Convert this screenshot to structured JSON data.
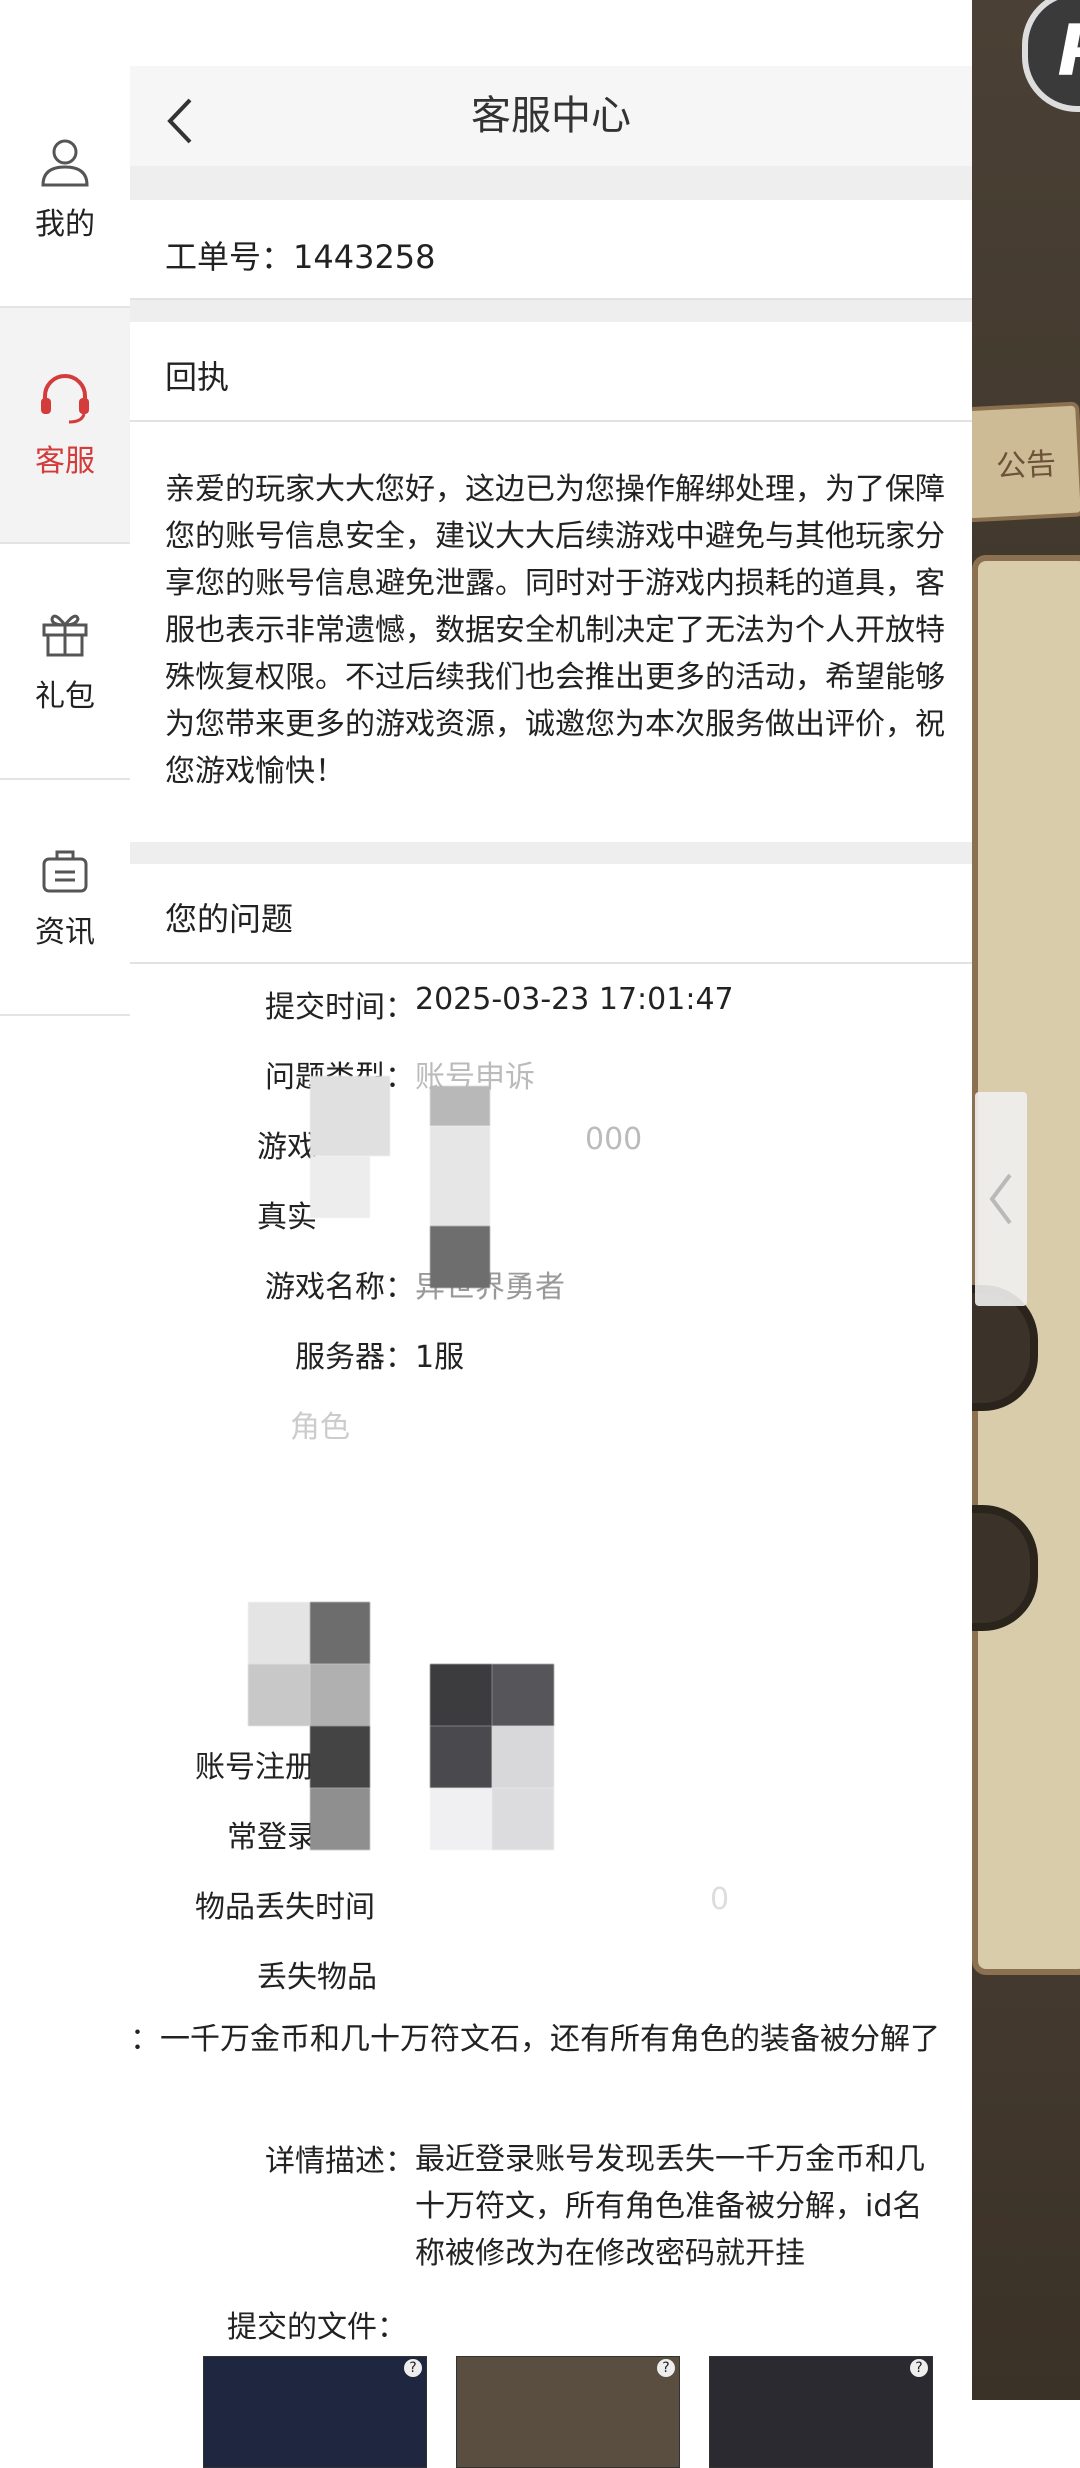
{
  "game_bg": {
    "logo_text": "P",
    "notice_label": "公告"
  },
  "nav": {
    "items": [
      {
        "label": "我的",
        "icon": "user-icon"
      },
      {
        "label": "客服",
        "icon": "headset-icon"
      },
      {
        "label": "礼包",
        "icon": "gift-icon"
      },
      {
        "label": "资讯",
        "icon": "news-bag-icon"
      }
    ],
    "active": "客服",
    "active_color": "#d43b3b"
  },
  "header": {
    "title": "客服中心",
    "back_icon": "chevron-left-icon"
  },
  "ticket": {
    "label": "工单号：1443258"
  },
  "reply": {
    "heading": "回执",
    "body": "亲爱的玩家大大您好，这边已为您操作解绑处理，为了保障您的账号信息安全，建议大大后续游戏中避免与其他玩家分享您的账号信息避免泄露。同时对于游戏内损耗的道具，客服也表示非常遗憾，数据安全机制决定了无法为个人开放特殊恢复权限。不过后续我们也会推出更多的活动，希望能够为您带来更多的游戏资源，诚邀您为本次服务做出评价，祝您游戏愉快！"
  },
  "question": {
    "heading": "您的问题",
    "submit_time_label": "提交时间：",
    "submit_time": "2025-03-23 17:01:47",
    "type_label": "问题类型：",
    "type_value": "账号申诉",
    "game_id_label": "游戏",
    "game_id_value": "000",
    "real_name_label": "真实",
    "game_name_label": "游戏名称：",
    "game_name_value": "异世界勇者",
    "server_label": "服务器：",
    "server_value": "1服",
    "role_label": "角色",
    "reg_label": "账号注册",
    "login_label": "常登录地",
    "lost_time_label": "物品丢失时间",
    "lost_time_value": "0",
    "lost_items_label": "丢失物品",
    "lost_items_value": "：一千万金币和几十万符文石，还有所有角色的装备被分解了",
    "detail_label": "详情描述：",
    "detail_value": "最近登录账号发现丢失一千万金币和几十万符文，所有角色准备被分解，id名称被修改为在修改密码就开挂",
    "files_label": "提交的文件："
  }
}
